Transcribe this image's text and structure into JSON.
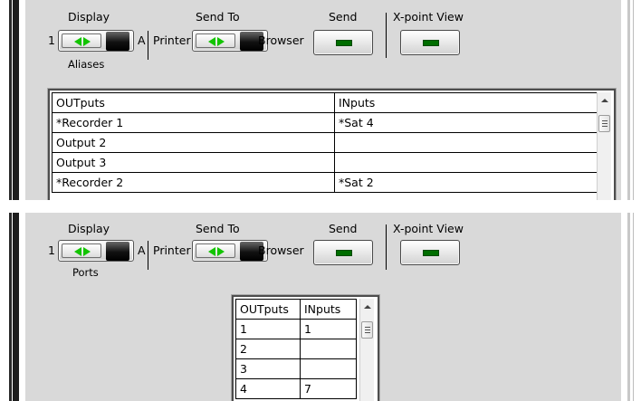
{
  "panels": [
    {
      "toggle_left": "1",
      "display_label": "Display",
      "toggle_right": "A",
      "display_mode": "Aliases",
      "printer_label": "Printer",
      "send_to_label": "Send To",
      "browser_label": "Browser",
      "send_label": "Send",
      "xpoint_label": "X-point View",
      "table": {
        "headers": [
          "OUTputs",
          "INputs"
        ],
        "rows": [
          [
            "*Recorder 1",
            "*Sat 4"
          ],
          [
            "Output  2",
            ""
          ],
          [
            "Output  3",
            ""
          ],
          [
            "*Recorder 2",
            "*Sat 2"
          ]
        ]
      }
    },
    {
      "toggle_left": "1",
      "display_label": "Display",
      "toggle_right": "A",
      "display_mode": "Ports",
      "printer_label": "Printer",
      "send_to_label": "Send To",
      "browser_label": "Browser",
      "send_label": "Send",
      "xpoint_label": "X-point View",
      "table": {
        "headers": [
          "OUTputs",
          "INputs"
        ],
        "rows": [
          [
            "1",
            "1"
          ],
          [
            "2",
            ""
          ],
          [
            "3",
            ""
          ],
          [
            "4",
            "7"
          ]
        ]
      }
    }
  ],
  "colors": {
    "led": "#006e00",
    "arrow": "#12c400",
    "panel_bg": "#d9d9d9"
  },
  "icons": [
    "toggle-arrows-icon",
    "scroll-up-icon",
    "scroll-thumb-grip-icon",
    "led-indicator-icon"
  ]
}
